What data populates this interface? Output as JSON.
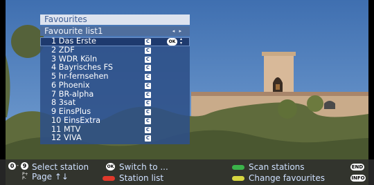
{
  "panel": {
    "title": "Favourites",
    "list_name": "Favourite list1",
    "nav_arrows": "◂ ▸",
    "channels": [
      {
        "label": "1 Das Erste",
        "badge": "C",
        "selected": true
      },
      {
        "label": "2 ZDF",
        "badge": "C"
      },
      {
        "label": "3 WDR Köln",
        "badge": "C"
      },
      {
        "label": "4 Bayrisches FS",
        "badge": "C"
      },
      {
        "label": "5 hr-fernsehen",
        "badge": "C"
      },
      {
        "label": "6 Phoenix",
        "badge": "C"
      },
      {
        "label": "7 BR-alpha",
        "badge": "C"
      },
      {
        "label": "8 3sat",
        "badge": "C"
      },
      {
        "label": "9 EinsPlus",
        "badge": "C"
      },
      {
        "label": "10 EinsExtra",
        "badge": "C"
      },
      {
        "label": "11 MTV",
        "badge": "C"
      },
      {
        "label": "12 VIVA",
        "badge": "C"
      }
    ],
    "ok_key": "OK",
    "updown": "▴\n▾"
  },
  "help": {
    "key_0": "0",
    "key_9": "9",
    "select_station": "Select station",
    "page": "Page ↑↓",
    "ok_key": "OK",
    "switch_to": "Switch to ...",
    "station_list": "Station list",
    "scan_stations": "Scan stations",
    "change_favourites": "Change favourites",
    "end_key": "END",
    "info_key": "INFO"
  },
  "colors": {
    "red": "#e0392b",
    "green": "#3bb34a",
    "yellow": "#d6d640"
  }
}
